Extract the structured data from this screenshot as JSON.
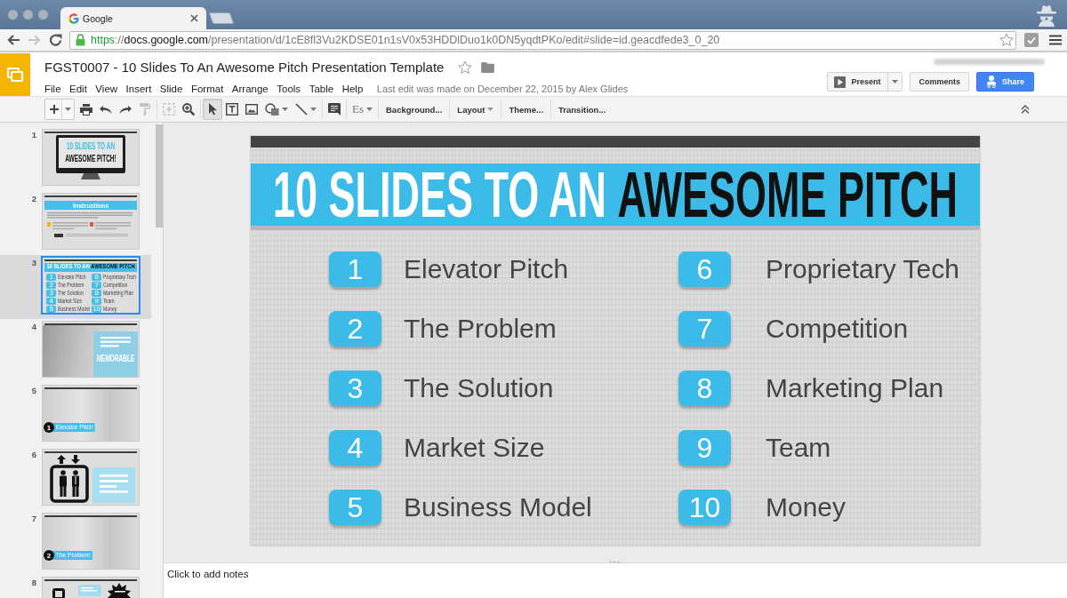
{
  "browser": {
    "tab": {
      "title": "Google"
    },
    "nav": [
      {
        "kind": "back",
        "disabled": false
      },
      {
        "kind": "forward",
        "disabled": true
      },
      {
        "kind": "reload",
        "disabled": false
      }
    ],
    "address": [
      {
        "kind": "scheme",
        "text": "https"
      },
      {
        "kind": "plain",
        "text": "://"
      },
      {
        "kind": "host",
        "text": "docs.google.com"
      },
      {
        "kind": "path",
        "text": "/presentation/d/1cE8fl3Vu2KDSE01n1sV0x53HDDlDuo1k0DN5yqdtPKo/edit#slide=id.geacdfede3_0_20"
      }
    ],
    "bookmarked": false
  },
  "document": {
    "title": "FGST0007 - 10 Slides To An Awesome Pitch Presentation Template",
    "starred": false,
    "menu": [
      "File",
      "Edit",
      "View",
      "Insert",
      "Slide",
      "Format",
      "Arrange",
      "Tools",
      "Table",
      "Help"
    ],
    "last_edit": "Last edit was made on December 22, 2015 by Alex Glides"
  },
  "actions": [
    {
      "kind": "present",
      "label": "Present"
    },
    {
      "kind": "comments",
      "label": "Comments"
    },
    {
      "kind": "share",
      "label": "Share"
    }
  ],
  "toolbar": {
    "groups": [
      {
        "tools": [
          {
            "kind": "new-slide",
            "dropdown": true,
            "selected": false,
            "disabled": false
          },
          {
            "kind": "print",
            "dropdown": false,
            "selected": false,
            "disabled": false
          },
          {
            "kind": "undo",
            "dropdown": false,
            "selected": false,
            "disabled": false
          },
          {
            "kind": "redo",
            "dropdown": false,
            "selected": false,
            "disabled": false
          },
          {
            "kind": "paint-format",
            "dropdown": false,
            "selected": false,
            "disabled": true
          }
        ]
      },
      {
        "tools": [
          {
            "kind": "fit",
            "dropdown": false,
            "selected": false,
            "disabled": true
          },
          {
            "kind": "zoom",
            "dropdown": false,
            "selected": false,
            "disabled": false
          }
        ]
      },
      {
        "tools": [
          {
            "kind": "select",
            "dropdown": false,
            "selected": true,
            "disabled": false
          },
          {
            "kind": "text-box",
            "dropdown": false,
            "selected": false,
            "disabled": false
          },
          {
            "kind": "image",
            "dropdown": false,
            "selected": false,
            "disabled": false
          },
          {
            "kind": "shape",
            "dropdown": true,
            "selected": false,
            "disabled": false
          },
          {
            "kind": "line",
            "dropdown": true,
            "selected": false,
            "disabled": false
          }
        ]
      },
      {
        "tools": [
          {
            "kind": "comment",
            "dropdown": false,
            "selected": false,
            "disabled": false
          }
        ]
      },
      {
        "tools": [
          {
            "kind": "input-tools",
            "label": "Es",
            "dropdown": true,
            "selected": false,
            "disabled": false
          }
        ]
      }
    ],
    "buttons": [
      {
        "label": "Background...",
        "dropdown": false
      },
      {
        "label": "Layout",
        "dropdown": true
      },
      {
        "label": "Theme...",
        "dropdown": false
      },
      {
        "label": "Transition...",
        "dropdown": false
      }
    ]
  },
  "filmstrip": [
    {
      "number": "1",
      "kind": "monitor",
      "selected": false,
      "lines": [
        "10 SLIDES TO AN",
        "AWESOME PITCH!"
      ]
    },
    {
      "number": "2",
      "kind": "instructions",
      "selected": false,
      "heading": "Instructions"
    },
    {
      "number": "3",
      "kind": "agenda",
      "selected": true,
      "title": "10 SLIDES TO AN **AWESOME PITCH**",
      "items": [
        {
          "number": "1",
          "label": "Elevator Pitch"
        },
        {
          "number": "2",
          "label": "The Problem"
        },
        {
          "number": "3",
          "label": "The Solution"
        },
        {
          "number": "4",
          "label": "Market Size"
        },
        {
          "number": "5",
          "label": "Business Model"
        },
        {
          "number": "6",
          "label": "Proprietary Tech"
        },
        {
          "number": "7",
          "label": "Competition"
        },
        {
          "number": "8",
          "label": "Marketing Plan"
        },
        {
          "number": "9",
          "label": "Team"
        },
        {
          "number": "10",
          "label": "Money"
        }
      ]
    },
    {
      "number": "4",
      "kind": "quote",
      "selected": false,
      "heading": "MEMORABLE"
    },
    {
      "number": "5",
      "kind": "caption",
      "selected": false,
      "badge": "1",
      "caption": "Elevator Pitch"
    },
    {
      "number": "6",
      "kind": "elevator",
      "selected": false
    },
    {
      "number": "7",
      "kind": "caption",
      "selected": false,
      "badge": "2",
      "caption": "The Problem"
    },
    {
      "number": "8",
      "kind": "partial",
      "selected": false
    }
  ],
  "slide": {
    "title": "10 SLIDES TO AN **AWESOME PITCH**",
    "items": [
      {
        "number": "1",
        "label": "Elevator Pitch"
      },
      {
        "number": "2",
        "label": "The Problem"
      },
      {
        "number": "3",
        "label": "The Solution"
      },
      {
        "number": "4",
        "label": "Market Size"
      },
      {
        "number": "5",
        "label": "Business Model"
      },
      {
        "number": "6",
        "label": "Proprietary Tech"
      },
      {
        "number": "7",
        "label": "Competition"
      },
      {
        "number": "8",
        "label": "Marketing Plan"
      },
      {
        "number": "9",
        "label": "Team"
      },
      {
        "number": "10",
        "label": "Money"
      }
    ]
  },
  "notes": {
    "placeholder": "Click to add notes"
  }
}
